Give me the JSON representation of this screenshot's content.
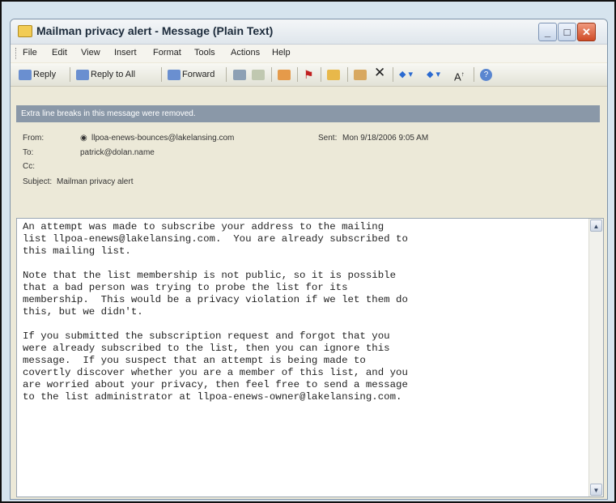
{
  "window": {
    "title": "Mailman privacy alert - Message (Plain Text)",
    "controls": {
      "minimize": "_",
      "maximize": "□",
      "close": "✕"
    }
  },
  "menu": [
    "File",
    "Edit",
    "View",
    "Insert",
    "Format",
    "Tools",
    "Actions",
    "Help"
  ],
  "toolbar": {
    "reply": "Reply",
    "reply_all": "Reply to All",
    "forward": "Forward",
    "font_grow": "A",
    "help": "?"
  },
  "info_bar": "Extra line breaks in this message were removed.",
  "headers": {
    "from_label": "From:",
    "from_value": "llpoa-enews-bounces@lakelansing.com",
    "sent_label": "Sent:",
    "sent_value": "Mon 9/18/2006 9:05 AM",
    "to_label": "To:",
    "to_value": "patrick@dolan.name",
    "cc_label": "Cc:",
    "cc_value": "",
    "subject_label": "Subject:",
    "subject_value": "Mailman privacy alert"
  },
  "body": "An attempt was made to subscribe your address to the mailing\nlist llpoa-enews@lakelansing.com.  You are already subscribed to\nthis mailing list.\n\nNote that the list membership is not public, so it is possible\nthat a bad person was trying to probe the list for its\nmembership.  This would be a privacy violation if we let them do\nthis, but we didn't.\n\nIf you submitted the subscription request and forgot that you\nwere already subscribed to the list, then you can ignore this\nmessage.  If you suspect that an attempt is being made to\ncovertly discover whether you are a member of this list, and you\nare worried about your privacy, then feel free to send a message\nto the list administrator at llpoa-enews-owner@lakelansing.com.",
  "colors": {
    "info_bar": "#8a98a8",
    "close_button": "#cf4b27",
    "title_icon": "#f2cc55"
  }
}
